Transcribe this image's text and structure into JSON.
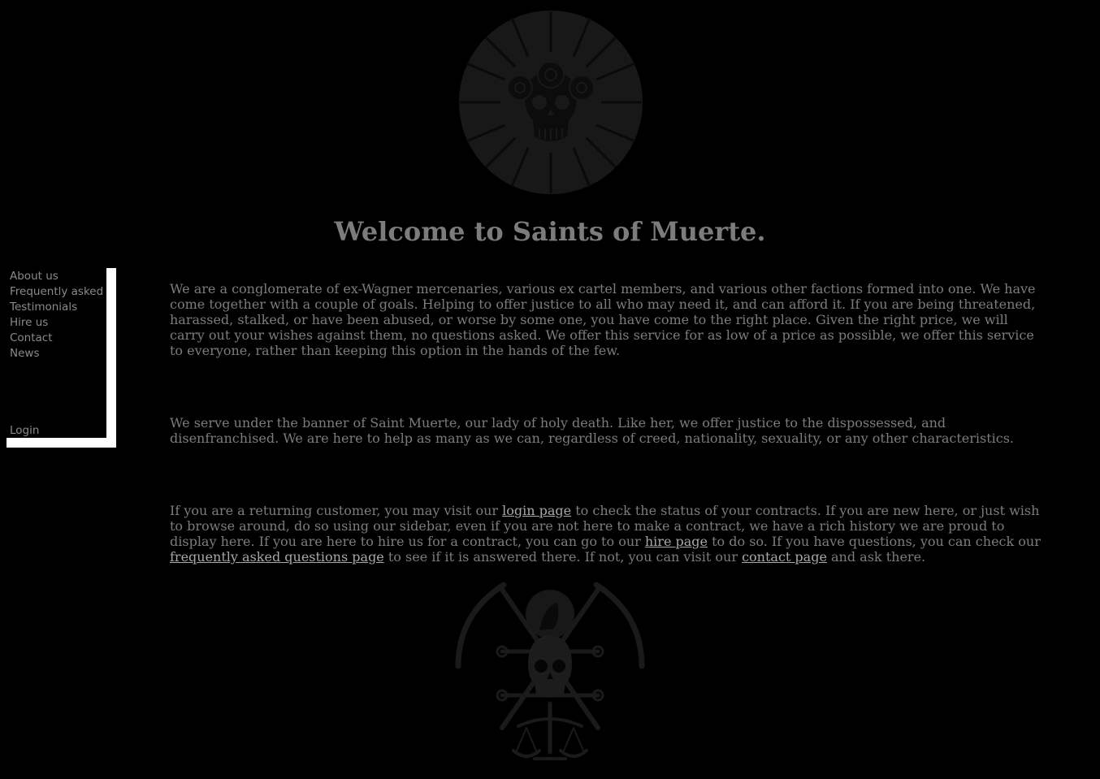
{
  "title": "Welcome to Saints of Muerte.",
  "sidebar": {
    "items": [
      {
        "label": "About us"
      },
      {
        "label": "Frequently asked"
      },
      {
        "label": "Testimonials"
      },
      {
        "label": "Hire us"
      },
      {
        "label": "Contact"
      },
      {
        "label": "News"
      }
    ],
    "login_label": "Login"
  },
  "content": {
    "p1": "We are a conglomerate of ex-Wagner mercenaries, various ex cartel members, and various other factions formed into one. We have come together with a couple of goals. Helping to offer justice to all who may need it, and can afford it. If you are being threatened, harassed, stalked, or have been abused, or worse by some one, you have come to the right place. Given the right price, we will carry out your wishes against them, no questions asked. We offer this service for as low of a price as possible, we offer this service to everyone, rather than keeping this option in the hands of the few.",
    "p2": "We serve under the banner of Saint Muerte, our lady of holy death. Like her, we offer justice to the dispossessed, and disenfranchised. We are here to help as many as we can, regardless of creed, nationality, sexuality, or any other characteristics.",
    "p3": {
      "t1": "If you are a returning customer, you may visit our ",
      "login_link": "login page",
      "t2": " to check the status of your contracts. If you are new here, or just wish to browse around, do so using our sidebar, even if you are not here to make a contract, we have a rich history we are proud to display here. If you are here to hire us for a contract, you can go to our ",
      "hire_link": "hire page",
      "t3": " to do so. If you have questions, you can check our ",
      "faq_link": "frequently asked questions page",
      "t4": " to see if it is answered there. If not, you can visit our ",
      "contact_link": "contact page",
      "t5": " and ask there."
    }
  },
  "icons": {
    "top_logo": "santa-muerte-skull-roses-emblem",
    "bottom_emblem": "skull-scythes-scales-emblem"
  },
  "colors": {
    "background": "#000000",
    "text": "#7c7c7c",
    "link": "#a8a8a8",
    "sidebar_border": "#ffffff",
    "emblem": "#1a1a1a"
  }
}
